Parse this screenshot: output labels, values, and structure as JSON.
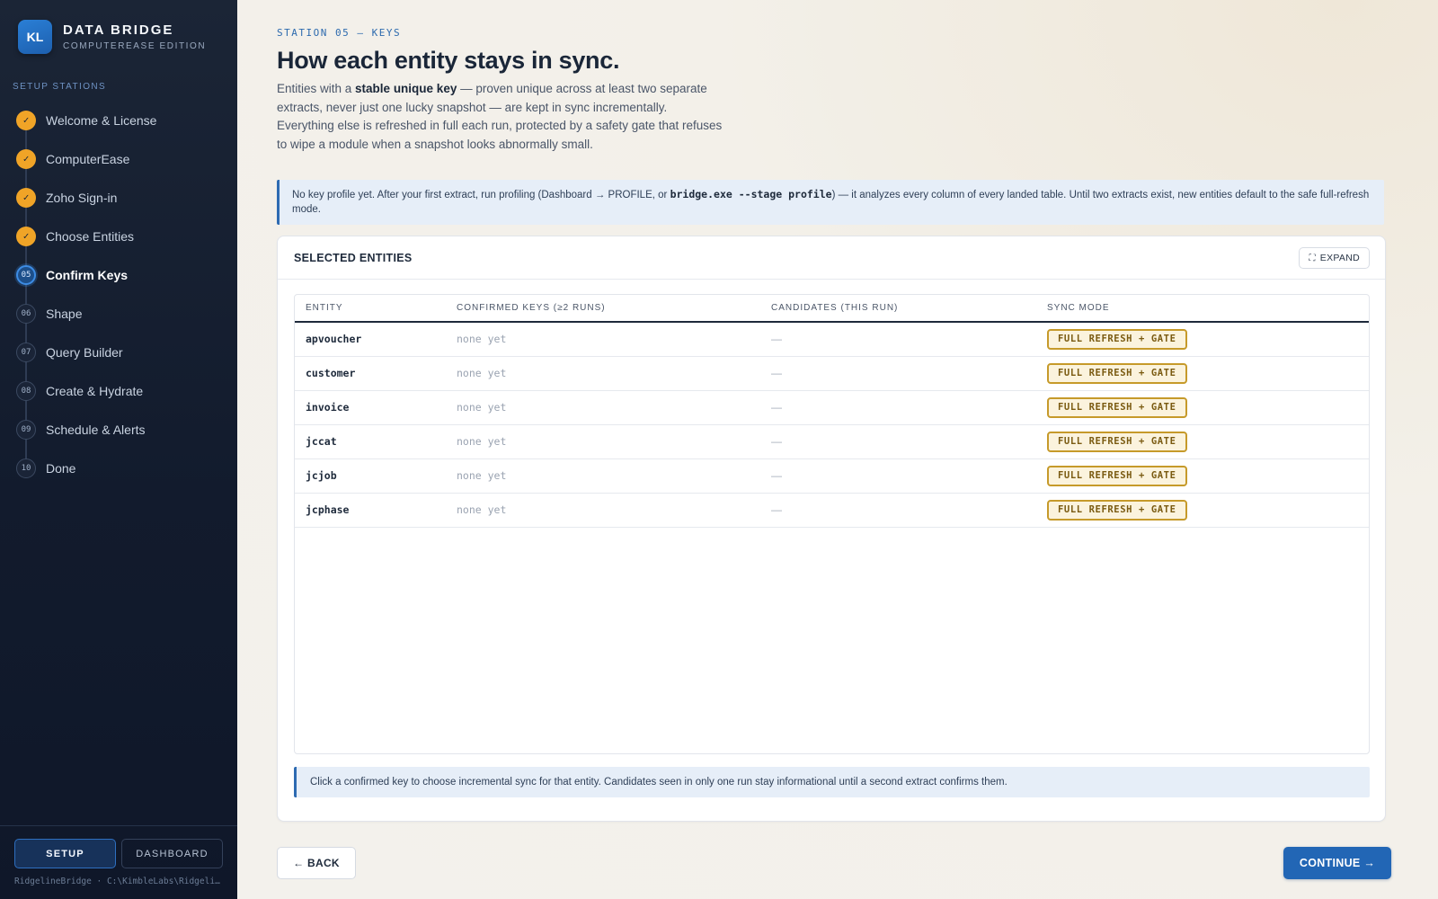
{
  "brand": {
    "badge": "KL",
    "title": "DATA BRIDGE",
    "subtitle": "COMPUTEREASE EDITION"
  },
  "sidebar": {
    "section_label": "SETUP STATIONS",
    "steps": [
      {
        "marker": "✓",
        "label": "Welcome & License",
        "state": "done"
      },
      {
        "marker": "✓",
        "label": "ComputerEase",
        "state": "done"
      },
      {
        "marker": "✓",
        "label": "Zoho Sign-in",
        "state": "done"
      },
      {
        "marker": "✓",
        "label": "Choose Entities",
        "state": "done"
      },
      {
        "marker": "05",
        "label": "Confirm Keys",
        "state": "current"
      },
      {
        "marker": "06",
        "label": "Shape",
        "state": "todo"
      },
      {
        "marker": "07",
        "label": "Query Builder",
        "state": "todo"
      },
      {
        "marker": "08",
        "label": "Create & Hydrate",
        "state": "todo"
      },
      {
        "marker": "09",
        "label": "Schedule & Alerts",
        "state": "todo"
      },
      {
        "marker": "10",
        "label": "Done",
        "state": "todo"
      }
    ],
    "mode_setup": "SETUP",
    "mode_dashboard": "DASHBOARD",
    "path": "RidgelineBridge · C:\\KimbleLabs\\Ridgeline\\"
  },
  "header": {
    "eyebrow": "STATION 05 — KEYS",
    "title": "How each entity stays in sync.",
    "lead_1": "Entities with a ",
    "lead_bold": "stable unique key",
    "lead_2": " — proven unique across at least two separate extracts, never just one lucky snapshot — are kept in sync incrementally. Everything else is refreshed in full each run, protected by a safety gate that refuses to wipe a module when a snapshot looks abnormally small."
  },
  "notice": {
    "text_1": "No key profile yet. After your first extract, run profiling (Dashboard → PROFILE, or ",
    "code": "bridge.exe --stage profile",
    "text_2": ") — it analyzes every column of every landed table. Until two extracts exist, new entities default to the safe full-refresh mode."
  },
  "card": {
    "title": "SELECTED ENTITIES",
    "expand_icon": "⛶",
    "expand_label": "EXPAND",
    "columns": [
      "ENTITY",
      "CONFIRMED KEYS (≥2 RUNS)",
      "CANDIDATES (THIS RUN)",
      "SYNC MODE"
    ],
    "rows": [
      {
        "entity": "apvoucher",
        "keys": "none yet",
        "candidates": "—",
        "mode": "FULL REFRESH + GATE"
      },
      {
        "entity": "customer",
        "keys": "none yet",
        "candidates": "—",
        "mode": "FULL REFRESH + GATE"
      },
      {
        "entity": "invoice",
        "keys": "none yet",
        "candidates": "—",
        "mode": "FULL REFRESH + GATE"
      },
      {
        "entity": "jccat",
        "keys": "none yet",
        "candidates": "—",
        "mode": "FULL REFRESH + GATE"
      },
      {
        "entity": "jcjob",
        "keys": "none yet",
        "candidates": "—",
        "mode": "FULL REFRESH + GATE"
      },
      {
        "entity": "jcphase",
        "keys": "none yet",
        "candidates": "—",
        "mode": "FULL REFRESH + GATE"
      }
    ],
    "hint": "Click a confirmed key to choose incremental sync for that entity. Candidates seen in only one run stay informational until a second extract confirms them."
  },
  "footer": {
    "back_label": "← BACK",
    "continue_label": "CONTINUE →"
  }
}
